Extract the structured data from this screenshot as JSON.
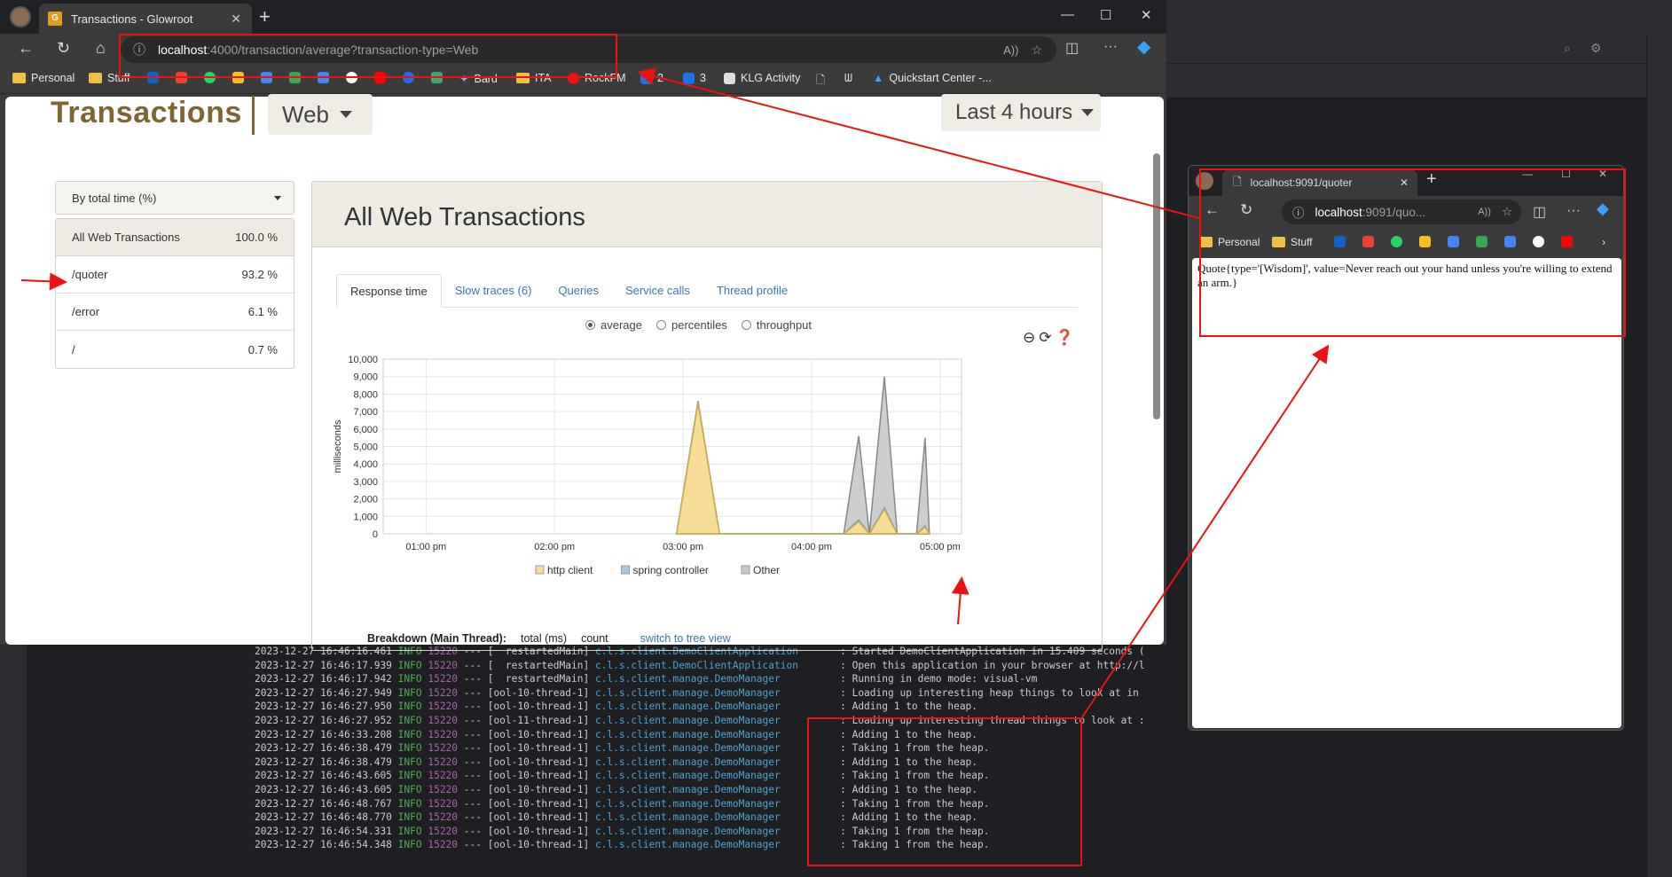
{
  "main_browser": {
    "tab_title": "Transactions - Glowroot",
    "url_host": "localhost",
    "url_path": ":4000/transaction/average?transaction-type=Web",
    "bookmarks": [
      "Personal",
      "Stuff",
      "Bard",
      "ITA",
      "RockFM",
      "2",
      "3",
      "KLG Activity",
      "Quickstart Center -..."
    ]
  },
  "page": {
    "title": "Transactions",
    "type_dropdown": "Web",
    "time_dropdown": "Last 4 hours",
    "sort_dropdown": "By total time (%)",
    "transactions": [
      {
        "name": "All Web Transactions",
        "pct": "100.0 %"
      },
      {
        "name": "/quoter",
        "pct": "93.2 %"
      },
      {
        "name": "/error",
        "pct": "6.1 %"
      },
      {
        "name": "/",
        "pct": "0.7 %"
      }
    ],
    "panel_title": "All Web Transactions",
    "tabs": [
      "Response time",
      "Slow traces (6)",
      "Queries",
      "Service calls",
      "Thread profile"
    ],
    "radios": [
      "average",
      "percentiles",
      "throughput"
    ],
    "breakdown": {
      "label": "Breakdown (Main Thread):",
      "col1": "total (ms)",
      "col2": "count",
      "link": "switch to tree view"
    }
  },
  "chart_data": {
    "type": "area",
    "ylabel": "milliseconds",
    "ylim": [
      0,
      10000
    ],
    "yticks": [
      "10,000",
      "9,000",
      "8,000",
      "7,000",
      "6,000",
      "5,000",
      "4,000",
      "3,000",
      "2,000",
      "1,000",
      "0"
    ],
    "xticks": [
      "01:00 pm",
      "02:00 pm",
      "03:00 pm",
      "04:00 pm",
      "05:00 pm"
    ],
    "legend": [
      "http client",
      "spring controller",
      "Other"
    ],
    "colors": {
      "http client": "#f6dc95",
      "spring controller": "#a8c6e6",
      "Other": "#c8c8c8"
    },
    "x": [
      "02:57 pm",
      "03:07 pm",
      "03:17 pm",
      "04:15 pm",
      "04:22 pm",
      "04:27 pm",
      "04:34 pm",
      "04:40 pm",
      "04:47 pm",
      "04:49 pm",
      "04:53 pm",
      "04:55 pm"
    ],
    "series": [
      {
        "name": "http client",
        "values": [
          0,
          7500,
          0,
          0,
          700,
          0,
          1400,
          0,
          0,
          0,
          400,
          0
        ]
      },
      {
        "name": "spring controller",
        "values": [
          0,
          7520,
          0,
          0,
          800,
          0,
          1500,
          0,
          0,
          0,
          450,
          0
        ]
      },
      {
        "name": "Other",
        "values": [
          0,
          7600,
          0,
          0,
          5600,
          0,
          9000,
          0,
          0,
          0,
          5500,
          0
        ]
      }
    ]
  },
  "popup_browser": {
    "tab_title": "localhost:9091/quoter",
    "url_host": "localhost",
    "url_path": ":9091/quo...",
    "bookmarks": [
      "Personal",
      "Stuff"
    ],
    "content": "Quote{type='[Wisdom]', value=Never reach out your hand unless you're willing to extend an arm.}"
  },
  "console": {
    "lines": [
      {
        "ts": "2023-12-27 16:46:16.461",
        "lvl": "INFO",
        "pid": "15220",
        "thr": "--- [  restartedMain]",
        "cls": "c.l.s.client.DemoClientApplication      ",
        "msg": ": Started DemoClientApplication in 15.409 seconds ("
      },
      {
        "ts": "2023-12-27 16:46:17.939",
        "lvl": "INFO",
        "pid": "15220",
        "thr": "--- [  restartedMain]",
        "cls": "c.l.s.client.DemoClientApplication      ",
        "msg": ": Open this application in your browser at http://l"
      },
      {
        "ts": "2023-12-27 16:46:17.942",
        "lvl": "INFO",
        "pid": "15220",
        "thr": "--- [  restartedMain]",
        "cls": "c.l.s.client.manage.DemoManager         ",
        "msg": ": Running in demo mode: visual-vm"
      },
      {
        "ts": "2023-12-27 16:46:27.949",
        "lvl": "INFO",
        "pid": "15220",
        "thr": "--- [ool-10-thread-1]",
        "cls": "c.l.s.client.manage.DemoManager         ",
        "msg": ": Loading up interesting heap things to look at in"
      },
      {
        "ts": "2023-12-27 16:46:27.950",
        "lvl": "INFO",
        "pid": "15220",
        "thr": "--- [ool-10-thread-1]",
        "cls": "c.l.s.client.manage.DemoManager         ",
        "msg": ": Adding 1 to the heap."
      },
      {
        "ts": "2023-12-27 16:46:27.952",
        "lvl": "INFO",
        "pid": "15220",
        "thr": "--- [ool-11-thread-1]",
        "cls": "c.l.s.client.manage.DemoManager         ",
        "msg": ": Loading up interesting thread things to look at :"
      },
      {
        "ts": "2023-12-27 16:46:33.208",
        "lvl": "INFO",
        "pid": "15220",
        "thr": "--- [ool-10-thread-1]",
        "cls": "c.l.s.client.manage.DemoManager         ",
        "msg": ": Adding 1 to the heap."
      },
      {
        "ts": "2023-12-27 16:46:38.479",
        "lvl": "INFO",
        "pid": "15220",
        "thr": "--- [ool-10-thread-1]",
        "cls": "c.l.s.client.manage.DemoManager         ",
        "msg": ": Taking 1 from the heap."
      },
      {
        "ts": "2023-12-27 16:46:38.479",
        "lvl": "INFO",
        "pid": "15220",
        "thr": "--- [ool-10-thread-1]",
        "cls": "c.l.s.client.manage.DemoManager         ",
        "msg": ": Adding 1 to the heap."
      },
      {
        "ts": "2023-12-27 16:46:43.605",
        "lvl": "INFO",
        "pid": "15220",
        "thr": "--- [ool-10-thread-1]",
        "cls": "c.l.s.client.manage.DemoManager         ",
        "msg": ": Taking 1 from the heap."
      },
      {
        "ts": "2023-12-27 16:46:43.605",
        "lvl": "INFO",
        "pid": "15220",
        "thr": "--- [ool-10-thread-1]",
        "cls": "c.l.s.client.manage.DemoManager         ",
        "msg": ": Adding 1 to the heap."
      },
      {
        "ts": "2023-12-27 16:46:48.767",
        "lvl": "INFO",
        "pid": "15220",
        "thr": "--- [ool-10-thread-1]",
        "cls": "c.l.s.client.manage.DemoManager         ",
        "msg": ": Taking 1 from the heap."
      },
      {
        "ts": "2023-12-27 16:46:48.770",
        "lvl": "INFO",
        "pid": "15220",
        "thr": "--- [ool-10-thread-1]",
        "cls": "c.l.s.client.manage.DemoManager         ",
        "msg": ": Adding 1 to the heap."
      },
      {
        "ts": "2023-12-27 16:46:54.331",
        "lvl": "INFO",
        "pid": "15220",
        "thr": "--- [ool-10-thread-1]",
        "cls": "c.l.s.client.manage.DemoManager         ",
        "msg": ": Taking 1 from the heap."
      },
      {
        "ts": "2023-12-27 16:46:54.348",
        "lvl": "INFO",
        "pid": "15220",
        "thr": "--- [ool-10-thread-1]",
        "cls": "c.l.s.client.manage.DemoManager         ",
        "msg": ": Taking 1 from the heap."
      }
    ]
  }
}
